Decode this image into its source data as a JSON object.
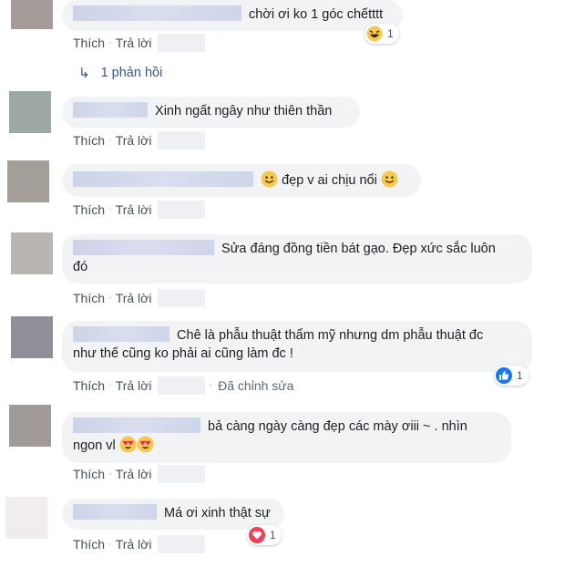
{
  "actions": {
    "like": "Thích",
    "reply": "Trả lời",
    "edited": "Đã chỉnh sửa"
  },
  "replies_link": "1 phản hồi",
  "comments": [
    {
      "text": "chời ơi ko 1 góc chếtttt",
      "reaction_count": "1",
      "reaction_type": "haha",
      "avatar_color": "#a59c9a"
    },
    {
      "text": "Xinh ngất ngây như thiên thần",
      "avatar_color": "#9ca7a6"
    },
    {
      "text": "đẹp v ai chịu nổi",
      "avatar_color": "#a49e99"
    },
    {
      "text_line1": "Sửa đáng đồng tiền bát gạo. Đẹp xức sắc luôn",
      "text_line2": "đó",
      "avatar_color": "#b9b5b1"
    },
    {
      "text_line1": "Chê là phẫu thuật thẩm mỹ nhưng dm phẫu thuật đc",
      "text_line2": "như thế cũng ko phải ai cũng làm đc !",
      "reaction_count": "1",
      "reaction_type": "like",
      "avatar_color": "#8e8f99"
    },
    {
      "text_line1": "bả càng ngày càng đẹp các mày ơiii ~ . nhìn",
      "text_line2": "ngon vl",
      "avatar_color": "#a09b99"
    },
    {
      "text": "Má ơi xinh thật sự",
      "reaction_count": "1",
      "reaction_type": "love",
      "avatar_color": "#f1edec"
    }
  ]
}
